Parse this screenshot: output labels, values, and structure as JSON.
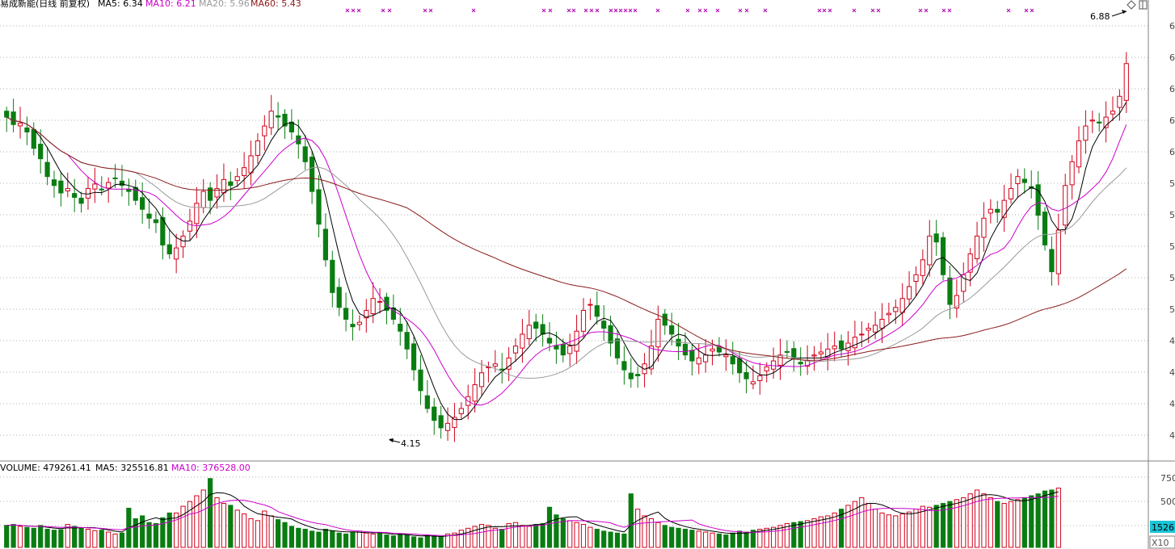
{
  "header": {
    "title": "易成新能(日线 前复权)",
    "ma5": "MA5: 6.34",
    "ma10": "MA10: 6.21",
    "ma20": "MA20: 5.96",
    "ma60": "MA60: 5.43"
  },
  "volume_header": {
    "volume": "VOLUME: 479261.41",
    "ma5": "MA5: 325516.81",
    "ma10": "MA10: 376528.00"
  },
  "annotations": {
    "high": "6.88",
    "low": "4.15"
  },
  "price_axis_ticks": [
    "6",
    "6",
    "6",
    "6",
    "6",
    "5",
    "5",
    "5",
    "5",
    "5",
    "4",
    "4",
    "4",
    "4"
  ],
  "volume_axis_ticks": [
    "750",
    "500"
  ],
  "right_controls": {
    "volume_badge": "1526",
    "unit": "X10"
  },
  "colors": {
    "up": "#d0021b",
    "down": "#0a7d12",
    "ma5": "#000000",
    "ma10": "#cc00cc",
    "ma20": "#9a9a9a",
    "ma60": "#8b1a1a",
    "grid": "#b0b0b0",
    "badge": "#19c4d6"
  },
  "chart_data": {
    "type": "candlestick",
    "title": "易成新能(日线 前复权)",
    "price_range": [
      4.05,
      6.95
    ],
    "volume_range": [
      0,
      760
    ],
    "close": [
      6.26,
      6.21,
      6.22,
      6.16,
      6.05,
      5.98,
      5.86,
      5.8,
      5.75,
      5.78,
      5.72,
      5.68,
      5.78,
      5.81,
      5.77,
      5.82,
      5.85,
      5.8,
      5.76,
      5.7,
      5.64,
      5.58,
      5.55,
      5.4,
      5.34,
      5.38,
      5.46,
      5.56,
      5.68,
      5.76,
      5.7,
      5.78,
      5.84,
      5.8,
      5.86,
      5.92,
      6.0,
      6.1,
      6.2,
      6.3,
      6.26,
      6.2,
      6.16,
      6.08,
      5.96,
      5.76,
      5.54,
      5.3,
      5.08,
      4.98,
      4.9,
      4.85,
      4.88,
      4.96,
      5.04,
      5.02,
      4.96,
      4.9,
      4.82,
      4.7,
      4.56,
      4.42,
      4.3,
      4.22,
      4.17,
      4.2,
      4.24,
      4.3,
      4.38,
      4.46,
      4.54,
      4.58,
      4.6,
      4.56,
      4.64,
      4.72,
      4.8,
      4.86,
      4.84,
      4.8,
      4.74,
      4.7,
      4.66,
      4.72,
      4.82,
      4.96,
      5.0,
      4.92,
      4.84,
      4.74,
      4.64,
      4.56,
      4.5,
      4.52,
      4.6,
      4.72,
      4.9,
      4.86,
      4.8,
      4.72,
      4.66,
      4.62,
      4.64,
      4.66,
      4.7,
      4.68,
      4.66,
      4.6,
      4.54,
      4.5,
      4.48,
      4.52,
      4.58,
      4.62,
      4.66,
      4.68,
      4.64,
      4.6,
      4.62,
      4.66,
      4.68,
      4.7,
      4.72,
      4.7,
      4.74,
      4.78,
      4.8,
      4.84,
      4.86,
      4.9,
      4.94,
      4.98,
      5.04,
      5.12,
      5.2,
      5.3,
      5.46,
      5.42,
      5.2,
      5.0,
      5.06,
      5.2,
      5.34,
      5.46,
      5.58,
      5.64,
      5.62,
      5.7,
      5.78,
      5.86,
      5.82,
      5.78,
      5.6,
      5.4,
      5.22,
      5.5,
      5.8,
      5.96,
      6.1,
      6.2,
      6.24,
      6.22,
      6.26,
      6.3,
      6.4,
      6.62
    ],
    "volume": [
      230,
      240,
      220,
      210,
      200,
      230,
      190,
      180,
      185,
      240,
      220,
      205,
      190,
      175,
      180,
      160,
      140,
      150,
      410,
      300,
      330,
      260,
      250,
      310,
      360,
      360,
      430,
      480,
      540,
      600,
      720,
      520,
      460,
      440,
      390,
      350,
      300,
      280,
      380,
      330,
      290,
      260,
      220,
      200,
      190,
      170,
      160,
      190,
      170,
      150,
      140,
      160,
      170,
      150,
      140,
      150,
      130,
      120,
      140,
      130,
      110,
      100,
      130,
      120,
      110,
      140,
      150,
      180,
      200,
      220,
      240,
      230,
      200,
      190,
      250,
      260,
      230,
      220,
      240,
      250,
      420,
      340,
      300,
      280,
      260,
      240,
      210,
      190,
      170,
      160,
      150,
      140,
      560,
      400,
      330,
      300,
      260,
      230,
      210,
      200,
      190,
      180,
      170,
      160,
      150,
      140,
      130,
      150,
      170,
      160,
      180,
      190,
      200,
      210,
      230,
      250,
      260,
      270,
      280,
      300,
      320,
      330,
      360,
      400,
      440,
      480,
      520,
      460,
      400,
      360,
      340,
      330,
      350,
      370,
      400,
      430,
      420,
      440,
      460,
      480,
      500,
      520,
      560,
      600,
      560,
      520,
      480,
      460,
      480,
      500,
      520,
      540,
      560,
      590,
      600,
      620
    ]
  }
}
